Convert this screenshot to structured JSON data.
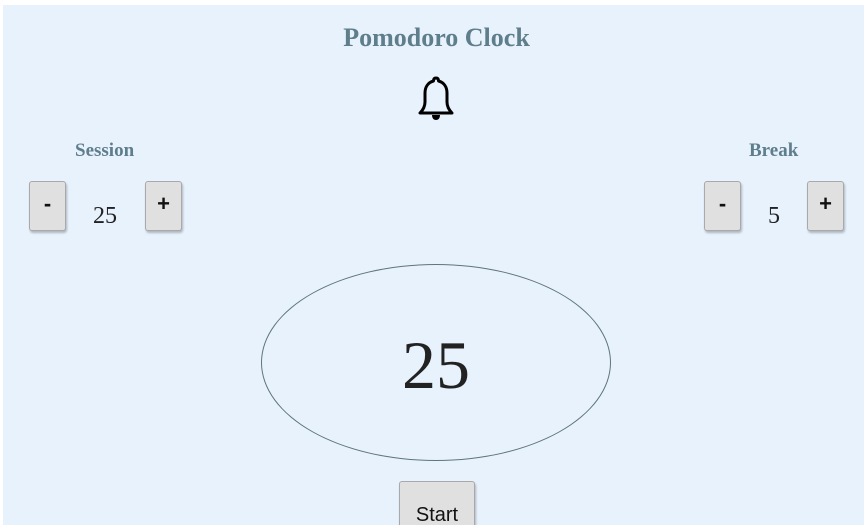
{
  "header": {
    "title": "Pomodoro Clock",
    "icon": "bell-icon"
  },
  "session": {
    "label": "Session",
    "decrement_label": "-",
    "value": "25",
    "increment_label": "+"
  },
  "break": {
    "label": "Break",
    "decrement_label": "-",
    "value": "5",
    "increment_label": "+"
  },
  "timer": {
    "display": "25"
  },
  "controls": {
    "start_label": "Start"
  },
  "colors": {
    "background": "#e8f2fd",
    "heading": "#5f7e8b",
    "button": "#e0e0e0",
    "clock_border": "#5f7578"
  }
}
